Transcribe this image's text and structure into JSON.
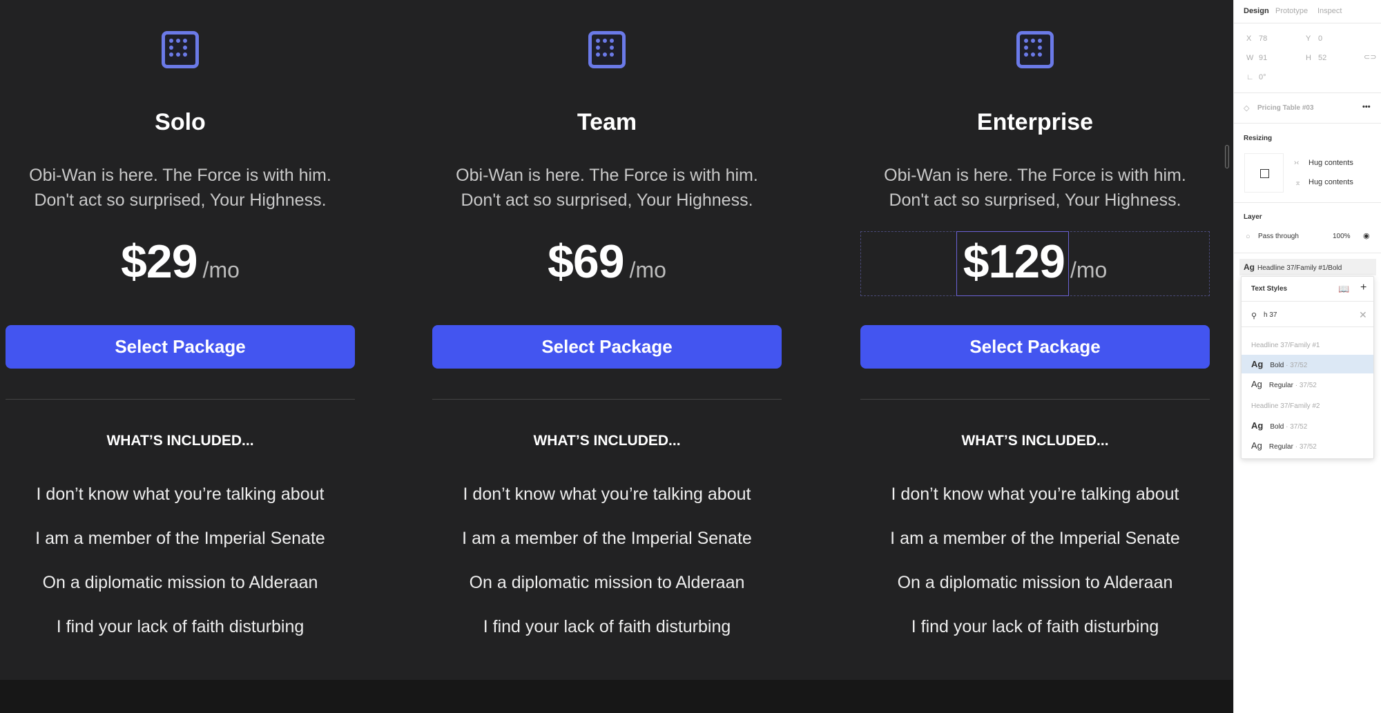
{
  "colors": {
    "accent": "#4355f0",
    "icon": "#6b7ae8",
    "background": "#222223"
  },
  "plans": [
    {
      "name": "Solo",
      "description": [
        "Obi-Wan is here. The Force is with him.",
        "Don't act so surprised, Your Highness."
      ],
      "price": "$29",
      "period": "/mo",
      "button": "Select Package",
      "included_heading": "WHAT’S INCLUDED...",
      "features": [
        "I don’t know what you’re talking about",
        "I am a member of the Imperial Senate",
        "On a diplomatic mission to Alderaan",
        "I find your lack of faith disturbing"
      ]
    },
    {
      "name": "Team",
      "description": [
        "Obi-Wan is here. The Force is with him.",
        "Don't act so surprised, Your Highness."
      ],
      "price": "$69",
      "period": "/mo",
      "button": "Select Package",
      "included_heading": "WHAT’S INCLUDED...",
      "features": [
        "I don’t know what you’re talking about",
        "I am a member of the Imperial Senate",
        "On a diplomatic mission to Alderaan",
        "I find your lack of faith disturbing"
      ]
    },
    {
      "name": "Enterprise",
      "description": [
        "Obi-Wan is here. The Force is with him.",
        "Don't act so surprised, Your Highness."
      ],
      "price": "$129",
      "period": "/mo",
      "button": "Select Package",
      "included_heading": "WHAT’S INCLUDED...",
      "features": [
        "I don’t know what you’re talking about",
        "I am a member of the Imperial Senate",
        "On a diplomatic mission to Alderaan",
        "I find your lack of faith disturbing"
      ]
    }
  ],
  "panel": {
    "tabs": [
      "Design",
      "Prototype",
      "Inspect"
    ],
    "x_label": "X",
    "x": "78",
    "y_label": "Y",
    "y": "0",
    "w_label": "W",
    "w": "91",
    "h_label": "H",
    "h": "52",
    "rotation": "0°",
    "component": "Pricing Table #03",
    "more": "•••",
    "resizing": {
      "title": "Resizing",
      "horizontal": "Hug contents",
      "vertical": "Hug contents"
    },
    "layer": {
      "title": "Layer",
      "blend": "Pass through",
      "opacity": "100%"
    },
    "text_style": {
      "ag": "Ag",
      "name": "Headline 37/Family #1/Bold"
    },
    "dropdown": {
      "title": "Text Styles",
      "search": "h 37",
      "groups": [
        {
          "name": "Headline 37/Family #1",
          "items": [
            {
              "ag": "Ag",
              "label": "Bold",
              "meta": "· 37/52",
              "selected": true
            },
            {
              "ag": "Ag",
              "label": "Regular",
              "meta": "· 37/52"
            }
          ]
        },
        {
          "name": "Headline 37/Family #2",
          "items": [
            {
              "ag": "Ag",
              "label": "Bold",
              "meta": "· 37/52"
            },
            {
              "ag": "Ag",
              "label": "Regular",
              "meta": "· 37/52"
            }
          ]
        }
      ]
    }
  }
}
